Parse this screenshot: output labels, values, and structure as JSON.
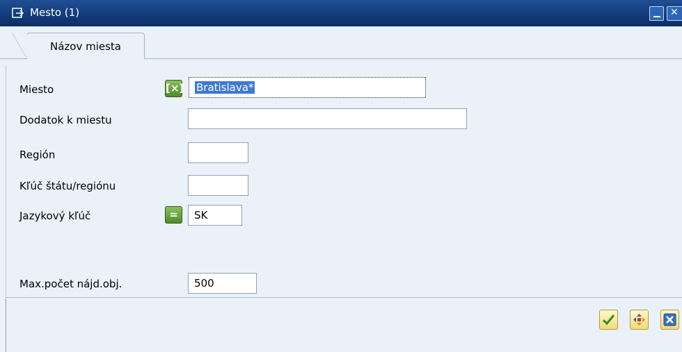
{
  "window": {
    "title": "Mesto (1)",
    "icons": {
      "title": "dialog-icon",
      "minimize": "minimize-icon",
      "close": "close-icon"
    }
  },
  "tabs": [
    {
      "label": "Názov miesta",
      "active": true
    }
  ],
  "form": {
    "miesto": {
      "label": "Miesto",
      "value": "Bratislava*",
      "operator_icon": "pattern-operator-icon"
    },
    "dodatok": {
      "label": "Dodatok k miestu",
      "value": ""
    },
    "region": {
      "label": "Región",
      "value": ""
    },
    "kluc_statu": {
      "label": "Kľúč štátu/regiónu",
      "value": ""
    },
    "jazyk": {
      "label": "Jazykový kľúč",
      "value": "SK",
      "operator_icon": "equals-operator-icon"
    },
    "max_pocet": {
      "label": "Max.počet nájd.obj.",
      "value": "500"
    }
  },
  "actions": {
    "continue": "checkmark-icon",
    "multiple_selection": "multiple-selection-icon",
    "cancel": "cancel-icon"
  },
  "colors": {
    "titlebar": "#123a78",
    "background": "#eaf1f8",
    "selection": "#3e78d3"
  }
}
